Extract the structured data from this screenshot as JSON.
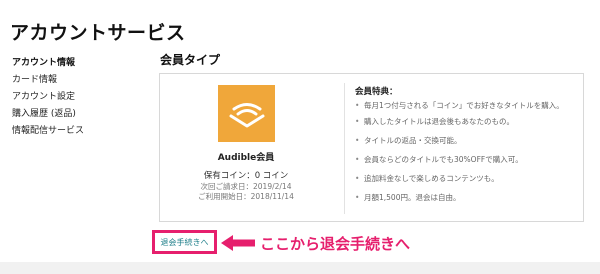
{
  "header": {
    "title": "アカウントサービス"
  },
  "sidebar": {
    "items": [
      {
        "label": "アカウント情報",
        "active": true
      },
      {
        "label": "カード情報"
      },
      {
        "label": "アカウント設定"
      },
      {
        "label": "購入履歴 (返品)"
      },
      {
        "label": "情報配信サービス"
      }
    ]
  },
  "main": {
    "section_title": "会員タイプ",
    "plan": {
      "logo_icon": "audible-logo-icon",
      "logo_color": "#f0a73a",
      "name": "Audible会員",
      "coins": "保有コイン：0 コイン",
      "next_billing": "次回ご請求日：2019/2/14",
      "start_date": "ご利用開始日：2018/11/14"
    },
    "benefits": {
      "title": "会員特典：",
      "items": [
        "毎月1つ付与される「コイン」でお好きなタイトルを購入。",
        "購入したタイトルは退会後もあなたのもの。",
        "タイトルの返品・交換可能。",
        "会員ならどのタイトルでも30%OFFで購入可。",
        "追加料金なしで楽しめるコンテンツも。",
        "月額1,500円。退会は自由。"
      ]
    },
    "cancel_button_label": "退会手続きへ"
  },
  "annotation": {
    "text": "ここから退会手続きへ",
    "color": "#e61f6d"
  }
}
